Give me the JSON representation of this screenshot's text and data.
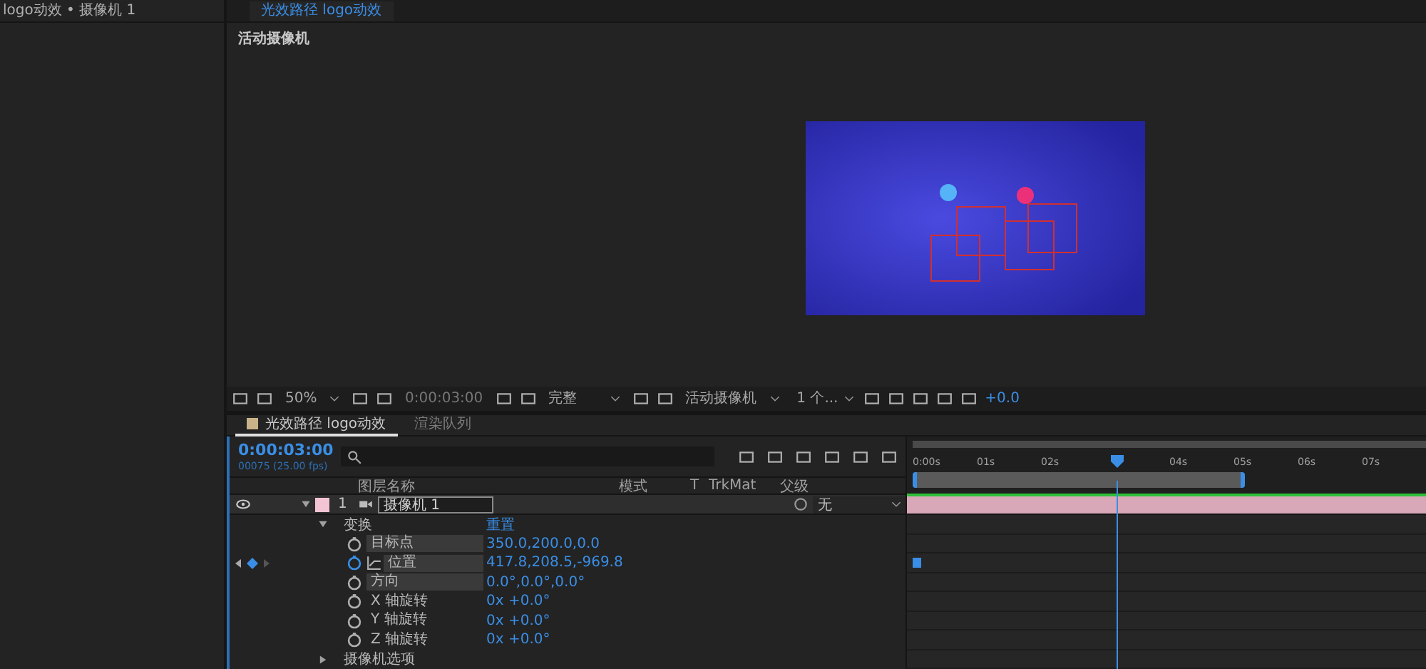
{
  "project_panel": {
    "title": "logo动效 • 摄像机 1"
  },
  "viewer": {
    "tab": {
      "label": "光效路径 logo动效",
      "selected": true
    },
    "label": "活动摄像机"
  },
  "viewer_toolbar": {
    "zoom": "50%",
    "timecode": "0:00:03:00",
    "resolution": "完整",
    "view": "活动摄像机",
    "views": "1 个...",
    "exposure": "+0.0"
  },
  "timeline": {
    "tabs": [
      {
        "label": "光效路径 logo动效",
        "selected": true
      },
      {
        "label": "渲染队列",
        "selected": false
      }
    ],
    "current_time": "0:00:03:00",
    "frame_info": "00075 (25.00 fps)",
    "columns": {
      "name": "图层名称",
      "mode": "模式",
      "t": "T",
      "trkmat": "TrkMat",
      "parent": "父级"
    },
    "layer": {
      "index": "1",
      "name": "摄像机 1",
      "color": "#f2c4d4",
      "visible": true,
      "expanded": true,
      "parent": "无"
    },
    "properties": [
      {
        "name": "变换",
        "expanded": true,
        "action": "重置",
        "children": [
          {
            "name": "目标点",
            "value": "350.0,200.0,0.0",
            "boxed": true,
            "keyframed": false
          },
          {
            "name": "位置",
            "value": "417.8,208.5,-969.8",
            "boxed": true,
            "keyframed": true
          },
          {
            "name": "方向",
            "value": "0.0°,0.0°,0.0°",
            "boxed": true,
            "keyframed": false
          },
          {
            "name": "X 轴旋转",
            "value": "0x +0.0°",
            "boxed": false,
            "keyframed": false
          },
          {
            "name": "Y 轴旋转",
            "value": "0x +0.0°",
            "boxed": false,
            "keyframed": false
          },
          {
            "name": "Z 轴旋转",
            "value": "0x +0.0°",
            "boxed": false,
            "keyframed": false
          }
        ]
      },
      {
        "name": "摄像机选项",
        "expanded": false
      }
    ],
    "ruler": {
      "ticks": [
        {
          "kind": "label",
          "label": "0:00s"
        },
        {
          "kind": "label",
          "label": "01s"
        },
        {
          "kind": "label",
          "label": "02s"
        },
        {
          "kind": "playhead"
        },
        {
          "kind": "label",
          "label": "04s"
        },
        {
          "kind": "work_area_end",
          "label": "05s"
        },
        {
          "kind": "label",
          "label": "06s"
        },
        {
          "kind": "label",
          "label": "07s"
        }
      ]
    }
  }
}
